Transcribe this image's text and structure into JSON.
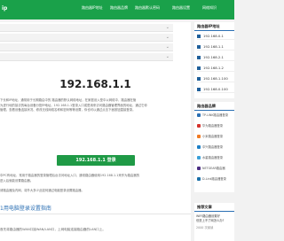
{
  "header": {
    "logo": "ip",
    "nav": [
      "路由器IP地址",
      "路由器品牌",
      "路由器默认密码",
      "路由器设置",
      "网络知识"
    ]
  },
  "main": {
    "notice_rows": [
      "",
      "",
      "",
      ""
    ],
    "ip_title": "192.168.1.1",
    "intro_lines": [
      "下长和IP地址，通常用于长期路由中的 路由器的默认网络地址，在家庭设入型中以网络中，路由器在管",
      "为进行地的接访的每台设备分配IP地址。192.168.1.1登录入口或是用来访问路由器管理界面的地址，通过它你",
      "管理。查看设备连接状况、修改无线网络名称和密码等等设置，你也可以通过点击下面按钮直接登录。"
    ],
    "login_button": "192.168.1.1 登录",
    "para_lines": [
      "中PC有地址，常用于路由器的登录管理后台访问地址入口，通常路由器使用192.168.1.1来作为路由器的",
      "进入后就能设置路由器。",
      "请路由器及内网，将外大多少此如何通过电脑登录设置路由器。"
    ],
    "subhead": "1用电脑登录设置指南",
    "last_line": "首先将路由器的WAN口接WAN/LAN口，上网电脑连接路由器的LAN口上。"
  },
  "sidebar": {
    "ip_section_title": "路由器IP地址",
    "ip_items": [
      "192.168.0.1",
      "192.168.1.1",
      "192.168.2.1",
      "192.168.1.2",
      "192.168.1.100",
      "192.168.0.100"
    ],
    "brand_section_title": "路由器品牌",
    "brand_items": [
      "TP-LINK路由器登录",
      "华为路由器登录",
      "小米路由器登录",
      "中兴路由器登录",
      "水星路由器登录",
      "NETGEAR路由器",
      "D-Link路由器登录"
    ],
    "rec_section_title": "推荐文章",
    "rec_lines": [
      "WIFI路由器设置好",
      "但是上不了网怎么办?",
      "无线路由器怎么设置"
    ],
    "rec_count": "2000 次阅读"
  },
  "colors": {
    "brand_green": "#1aa14a",
    "button_green": "#1f9a46",
    "link_blue": "#2b6fb3",
    "icon_blue": "#1f5f9a"
  },
  "icons": {
    "notice_chevron": "chevron-down-icon",
    "ip_marker": "square-bullet-icon",
    "brand_link": "brand-logo-icon"
  }
}
